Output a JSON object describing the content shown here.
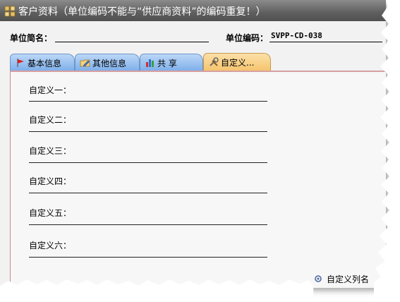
{
  "window": {
    "title": "客户资料（单位编码不能与“供应商资料”的编码重复！）"
  },
  "header": {
    "short_name_label": "单位简名：",
    "short_name_value": "",
    "code_label": "单位编码：",
    "code_value": "SVPP-CD-038"
  },
  "tabs": [
    {
      "label": "基本信息",
      "icon": "flag-icon",
      "active": false
    },
    {
      "label": "其他信息",
      "icon": "folder-edit-icon",
      "active": false
    },
    {
      "label": "共 享",
      "icon": "bar-chart-icon",
      "active": false
    },
    {
      "label": "自定义...",
      "icon": "tools-icon",
      "active": true
    }
  ],
  "custom_fields": [
    {
      "label": "自定义一：",
      "value": ""
    },
    {
      "label": "自定义二：",
      "value": ""
    },
    {
      "label": "自定义三：",
      "value": ""
    },
    {
      "label": "自定义四：",
      "value": ""
    },
    {
      "label": "自定义五：",
      "value": ""
    },
    {
      "label": "自定义六：",
      "value": ""
    }
  ],
  "footer": {
    "rename_link": "自定义列名"
  },
  "colors": {
    "titlebar": "#5f5f5f",
    "tab_inactive": "#7fb0ea",
    "tab_active": "#f5c46c",
    "panel_border": "#c98a8a"
  }
}
